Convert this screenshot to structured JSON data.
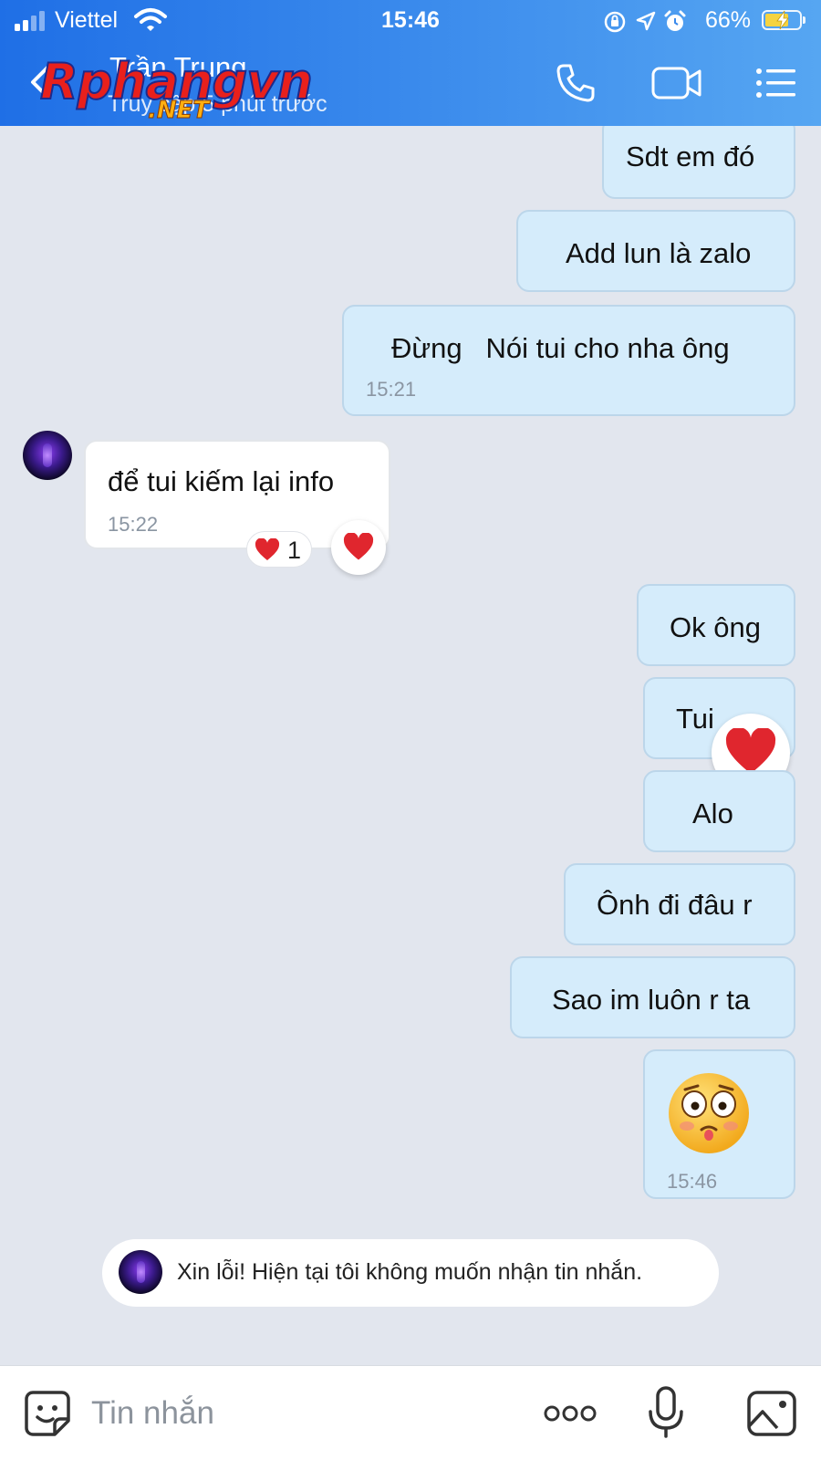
{
  "status_bar": {
    "carrier": "Viettel",
    "time": "15:46",
    "battery": "66%"
  },
  "header": {
    "contact_name": "Trần Trung",
    "last_seen": "Truy cập 5 phút trước",
    "watermark_main": "Rphangvn",
    "watermark_net": ".NET",
    "icons": [
      "back-icon",
      "phone-icon",
      "video-call-icon",
      "menu-icon"
    ]
  },
  "messages": [
    {
      "dir": "out",
      "text": "Sdt em đó"
    },
    {
      "dir": "out",
      "text": "Add lun là zalo"
    },
    {
      "dir": "out",
      "text": "Đừng   Nói tui cho nha ông",
      "time": "15:21"
    },
    {
      "dir": "in",
      "text": "để tui kiếm lại info",
      "time": "15:22",
      "reaction_emoji": "❤️",
      "reaction_count": "1"
    },
    {
      "dir": "out",
      "text": "Ok ông"
    },
    {
      "dir": "out",
      "text": "Tui"
    },
    {
      "dir": "out",
      "text": "Alo"
    },
    {
      "dir": "out",
      "text": "Ônh đi đâu r"
    },
    {
      "dir": "out",
      "text": "Sao im luôn r ta"
    },
    {
      "dir": "out",
      "sticker": "shocked-face-sticker",
      "time": "15:46"
    }
  ],
  "system_note": "Xin lỗi! Hiện tại tôi không muốn nhận tin nhắn.",
  "composer": {
    "placeholder": "Tin nhắn",
    "icons": [
      "sticker-icon",
      "more-icon",
      "microphone-icon",
      "image-icon"
    ]
  },
  "colors": {
    "header_gradient_start": "#1f6fe6",
    "header_gradient_end": "#56a6f2",
    "outgoing_bubble": "#d5ecfb",
    "incoming_bubble": "#ffffff",
    "chat_background": "#e2e6ee",
    "heart": "#e0262e"
  }
}
